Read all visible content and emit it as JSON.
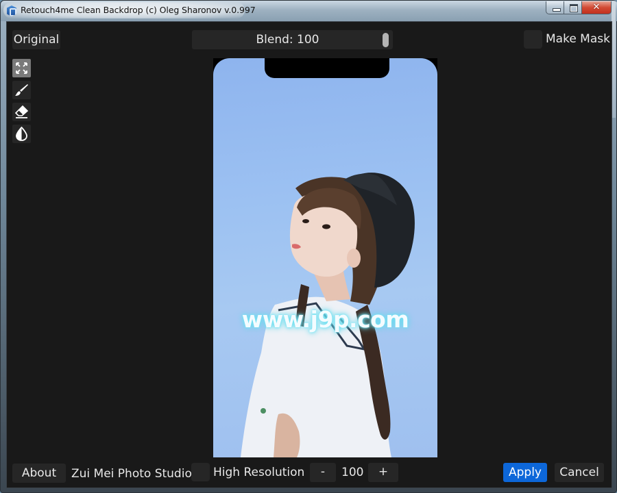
{
  "window": {
    "title": "Retouch4me Clean Backdrop (c) Oleg Sharonov v.0.997",
    "controls": {
      "minimize": "minimize",
      "maximize": "maximize",
      "close": "✕"
    }
  },
  "toolbar": {
    "original_label": "Original",
    "blend": {
      "label": "Blend: 100",
      "value": 100,
      "max": 100
    },
    "make_mask": {
      "label": "Make Mask",
      "checked": false
    }
  },
  "tools": [
    {
      "name": "fit-to-screen",
      "icon": "expand-icon",
      "active": true
    },
    {
      "name": "brush",
      "icon": "brush-icon",
      "active": false
    },
    {
      "name": "eraser",
      "icon": "eraser-icon",
      "active": false
    },
    {
      "name": "contrast",
      "icon": "contrast-drop-icon",
      "active": false
    }
  ],
  "preview": {
    "description": "Portrait photo of a girl in a black hat and white shirt against a blue sky, phone-screen frame with notch",
    "watermark": "www.j9p.com"
  },
  "footer": {
    "about_label": "About",
    "studio_name": "Zui Mei Photo Studio",
    "high_resolution": {
      "label": "High Resolution",
      "checked": false
    },
    "minus_label": "-",
    "resolution_value": "100",
    "plus_label": "+",
    "apply_label": "Apply",
    "cancel_label": "Cancel"
  },
  "colors": {
    "background": "#191919",
    "control": "#262626",
    "accent": "#0d67d9",
    "text": "#e8e8e8"
  }
}
